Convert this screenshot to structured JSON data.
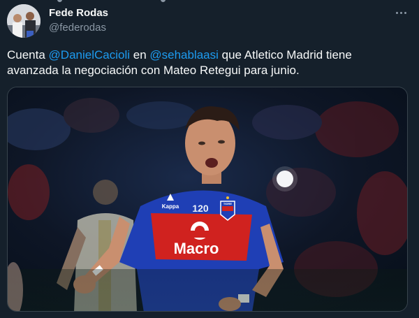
{
  "author": {
    "name": "Fede Rodas",
    "handle": "@federodas"
  },
  "tweet": {
    "segments": [
      {
        "text": "Cuenta ",
        "mention": false
      },
      {
        "text": "@DanielCacioli",
        "mention": true
      },
      {
        "text": " en ",
        "mention": false
      },
      {
        "text": "@sehablaasi",
        "mention": true
      },
      {
        "text": " que Atletico Madrid tiene avanzada la negociación con Mateo Retegui para junio.",
        "mention": false
      }
    ]
  },
  "photo": {
    "shirt_sponsor": "Macro",
    "shirt_badge": "120",
    "crest_text": "TIGRE",
    "kit_brand": "Kappa"
  },
  "colors": {
    "background": "#15202b",
    "text": "#f7f9f9",
    "secondary": "#8b98a5",
    "link": "#1d9bf0",
    "shirt_blue": "#1f3fb5",
    "shirt_red": "#d0221f"
  },
  "icons": {
    "more": "more-horizontal-icon"
  }
}
